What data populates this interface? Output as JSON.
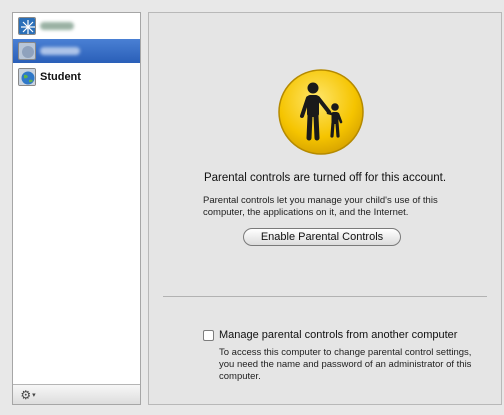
{
  "sidebar": {
    "users": [
      {
        "name": "",
        "obscured": true,
        "selected": false,
        "avatar": "snowflake-avatar"
      },
      {
        "name": "",
        "obscured": true,
        "selected": true,
        "avatar": "blurred-avatar"
      },
      {
        "name": "Student",
        "obscured": false,
        "selected": false,
        "avatar": "globe-avatar"
      }
    ],
    "action_menu": {
      "icon": "gear-icon",
      "caret": "▾"
    }
  },
  "main": {
    "icon": "parental-controls-icon",
    "status_title": "Parental controls are turned off for this account.",
    "status_description": "Parental controls let you manage your child's use of this computer, the applications on it, and the Internet.",
    "enable_button_label": "Enable Parental Controls",
    "remote_checkbox_label": "Manage parental controls from another computer",
    "remote_checkbox_checked": false,
    "remote_description": "To access this computer to change parental control settings, you need the name and password of an administrator of this computer."
  },
  "colors": {
    "selection": "#3a6fc6",
    "icon_yellow": "#f5c400",
    "panel_background": "#e5e5e5"
  }
}
